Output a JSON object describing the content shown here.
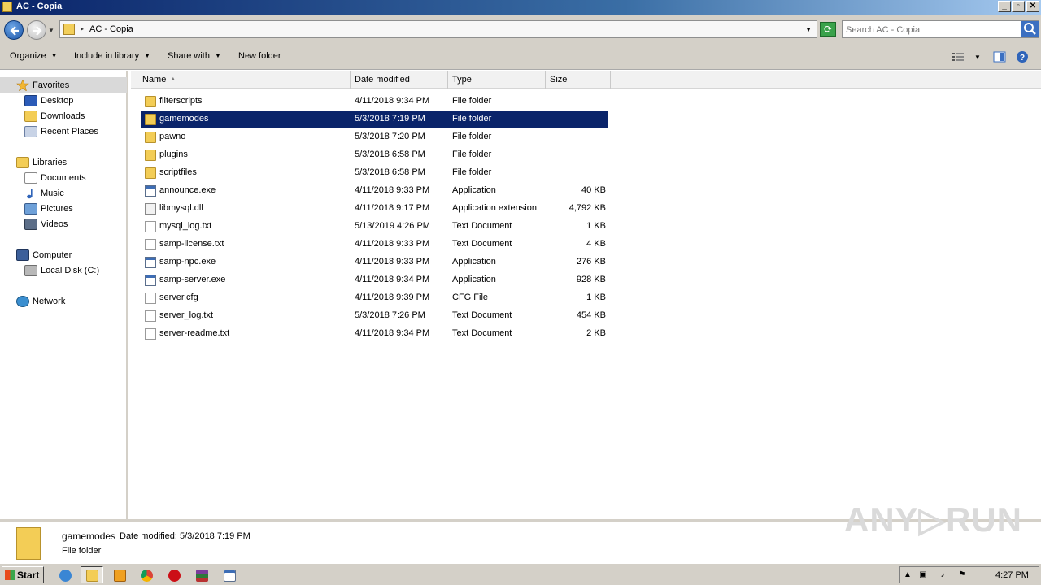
{
  "window": {
    "title": "AC - Copia",
    "btn_min": "_",
    "btn_max": "▫",
    "btn_close": "✕"
  },
  "address": {
    "path": "AC - Copia",
    "search_placeholder": "Search AC - Copia"
  },
  "toolbar": {
    "organize": "Organize",
    "include_in_library": "Include in library",
    "share_with": "Share with",
    "new_folder": "New folder"
  },
  "nav": {
    "favorites": "Favorites",
    "desktop": "Desktop",
    "downloads": "Downloads",
    "recent_places": "Recent Places",
    "libraries": "Libraries",
    "documents": "Documents",
    "music": "Music",
    "pictures": "Pictures",
    "videos": "Videos",
    "computer": "Computer",
    "local_disk": "Local Disk (C:)",
    "network": "Network"
  },
  "columns": {
    "name": "Name",
    "date": "Date modified",
    "type": "Type",
    "size": "Size"
  },
  "files": [
    {
      "name": "filterscripts",
      "date": "4/11/2018 9:34 PM",
      "type": "File folder",
      "size": "",
      "icon": "folder-icon"
    },
    {
      "name": "gamemodes",
      "date": "5/3/2018 7:19 PM",
      "type": "File folder",
      "size": "",
      "icon": "folder-icon"
    },
    {
      "name": "pawno",
      "date": "5/3/2018 7:20 PM",
      "type": "File folder",
      "size": "",
      "icon": "folder-icon"
    },
    {
      "name": "plugins",
      "date": "5/3/2018 6:58 PM",
      "type": "File folder",
      "size": "",
      "icon": "folder-icon"
    },
    {
      "name": "scriptfiles",
      "date": "5/3/2018 6:58 PM",
      "type": "File folder",
      "size": "",
      "icon": "folder-icon"
    },
    {
      "name": "announce.exe",
      "date": "4/11/2018 9:33 PM",
      "type": "Application",
      "size": "40 KB",
      "icon": "application-icon"
    },
    {
      "name": "libmysql.dll",
      "date": "4/11/2018 9:17 PM",
      "type": "Application extension",
      "size": "4,792 KB",
      "icon": "dll-icon"
    },
    {
      "name": "mysql_log.txt",
      "date": "5/13/2019 4:26 PM",
      "type": "Text Document",
      "size": "1 KB",
      "icon": "text-document-icon"
    },
    {
      "name": "samp-license.txt",
      "date": "4/11/2018 9:33 PM",
      "type": "Text Document",
      "size": "4 KB",
      "icon": "text-document-icon"
    },
    {
      "name": "samp-npc.exe",
      "date": "4/11/2018 9:33 PM",
      "type": "Application",
      "size": "276 KB",
      "icon": "application-icon"
    },
    {
      "name": "samp-server.exe",
      "date": "4/11/2018 9:34 PM",
      "type": "Application",
      "size": "928 KB",
      "icon": "application-icon"
    },
    {
      "name": "server.cfg",
      "date": "4/11/2018 9:39 PM",
      "type": "CFG File",
      "size": "1 KB",
      "icon": "cfg-file-icon"
    },
    {
      "name": "server_log.txt",
      "date": "5/3/2018 7:26 PM",
      "type": "Text Document",
      "size": "454 KB",
      "icon": "text-document-icon"
    },
    {
      "name": "server-readme.txt",
      "date": "4/11/2018 9:34 PM",
      "type": "Text Document",
      "size": "2 KB",
      "icon": "text-document-icon"
    }
  ],
  "details": {
    "name": "gamemodes",
    "modified": "Date modified: 5/3/2018 7:19 PM",
    "type": "File folder"
  },
  "watermark": "ANY▷RUN",
  "taskbar": {
    "start": "Start",
    "clock": "4:27 PM"
  },
  "colors": {
    "selection": "#0a246a",
    "titlebar": "#0a246a",
    "face": "#d4d0c8"
  }
}
